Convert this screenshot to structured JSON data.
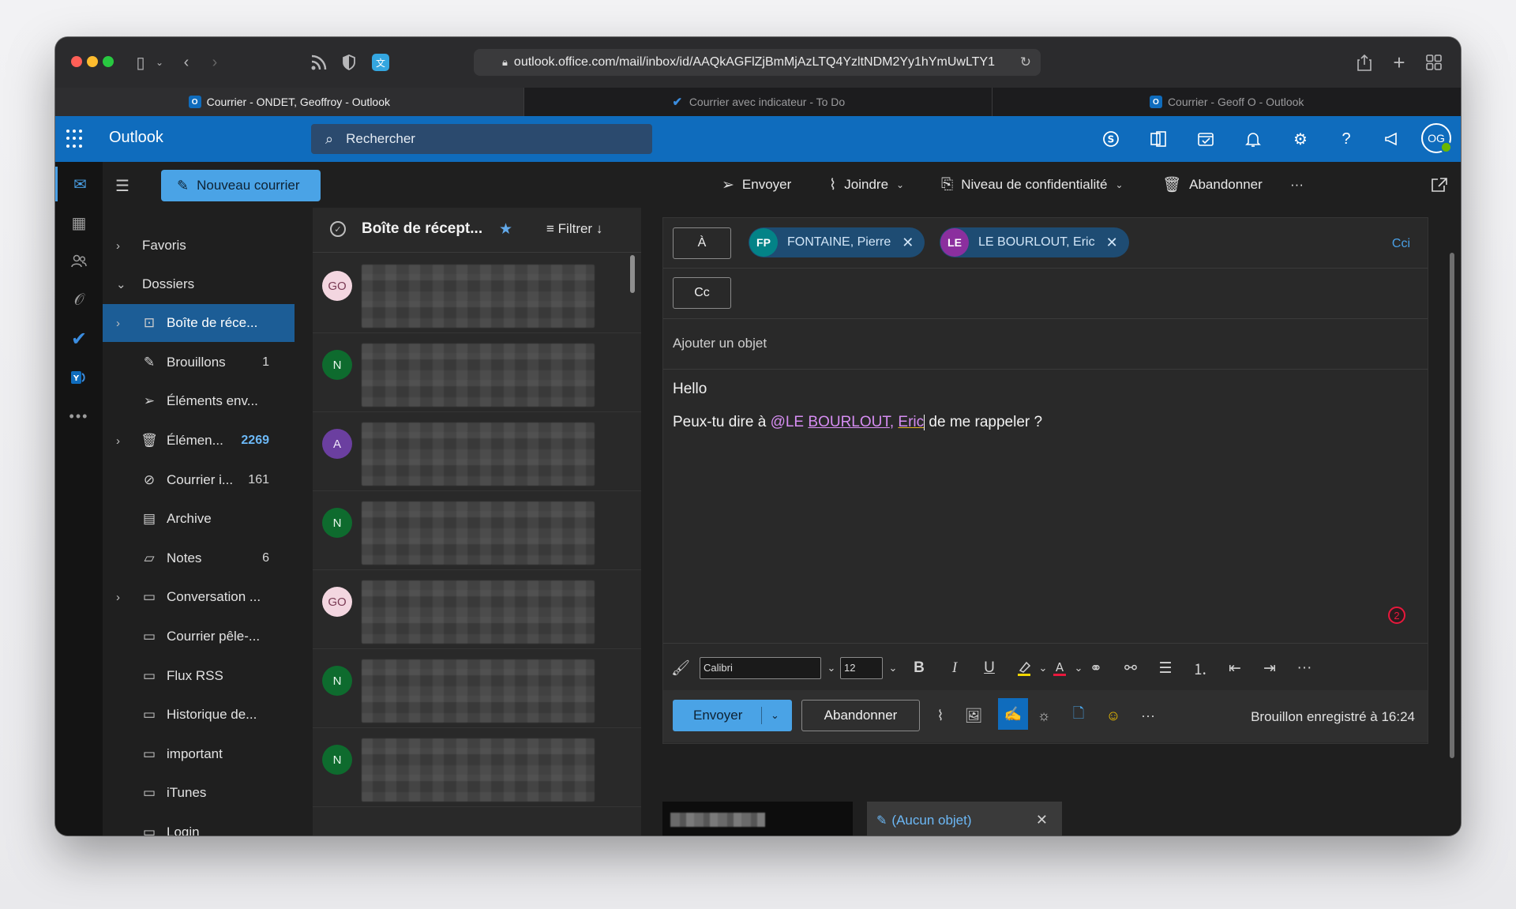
{
  "browser": {
    "url": "outlook.office.com/mail/inbox/id/AAQkAGFlZjBmMjAzLTQ4YzltNDM2Yy1hYmUwLTY1",
    "tabs": [
      {
        "label": "Courrier - ONDET, Geoffroy - Outlook",
        "icon": "outlook-icon"
      },
      {
        "label": "Courrier avec indicateur - To Do",
        "icon": "todo-check-icon"
      },
      {
        "label": "Courrier - Geoff O - Outlook",
        "icon": "outlook-icon"
      }
    ]
  },
  "header": {
    "app_name": "Outlook",
    "search_placeholder": "Rechercher",
    "user_initials": "OG"
  },
  "folder_pane": {
    "new_mail_label": "Nouveau courrier",
    "favorites_label": "Favoris",
    "folders_label": "Dossiers",
    "items": [
      {
        "label": "Boîte de réce...",
        "count": ""
      },
      {
        "label": "Brouillons",
        "count": "1"
      },
      {
        "label": "Éléments env...",
        "count": ""
      },
      {
        "label": "Élémen...",
        "count": "2269"
      },
      {
        "label": "Courrier i...",
        "count": "161"
      },
      {
        "label": "Archive",
        "count": ""
      },
      {
        "label": "Notes",
        "count": "6"
      },
      {
        "label": "Conversation ...",
        "count": ""
      },
      {
        "label": "Courrier pêle-...",
        "count": ""
      },
      {
        "label": "Flux RSS",
        "count": ""
      },
      {
        "label": "Historique de...",
        "count": ""
      },
      {
        "label": "important",
        "count": ""
      },
      {
        "label": "iTunes",
        "count": ""
      },
      {
        "label": "Login",
        "count": ""
      }
    ]
  },
  "message_list": {
    "title": "Boîte de récept...",
    "filter_label": "Filtrer",
    "senders": [
      "GO",
      "N",
      "A",
      "N",
      "GO",
      "N",
      "N"
    ]
  },
  "compose_toolbar": {
    "send": "Envoyer",
    "attach": "Joindre",
    "sensitivity": "Niveau de confidentialité",
    "discard": "Abandonner",
    "more": "···"
  },
  "compose": {
    "to_label": "À",
    "cc_label": "Cc",
    "bcc_label": "Cci",
    "recipients": [
      {
        "initials": "FP",
        "name": "FONTAINE, Pierre",
        "color": "#038387"
      },
      {
        "initials": "LE",
        "name": "LE BOURLOUT, Eric",
        "color": "#8b2f9e"
      }
    ],
    "subject_placeholder": "Ajouter un objet",
    "body_line1": "Hello",
    "body_line2_pre": "Peux-tu dire à ",
    "mention_at": "@LE ",
    "mention_last": "BOURLOUT",
    "mention_comma": ", ",
    "mention_first": "Eric",
    "body_line2_post": " de me rappeler ?",
    "issue_count": "2",
    "font_name": "Calibri",
    "font_size": "12",
    "send_label": "Envoyer",
    "discard_label": "Abandonner",
    "more_label": "···",
    "draft_status": "Brouillon enregistré à 16:24"
  },
  "bottom_tabs": {
    "draft_tab_label": "(Aucun objet)"
  },
  "colors": {
    "brand_blue": "#0f6cbd",
    "accent": "#4aa3e6",
    "mention": "#d68df2"
  }
}
